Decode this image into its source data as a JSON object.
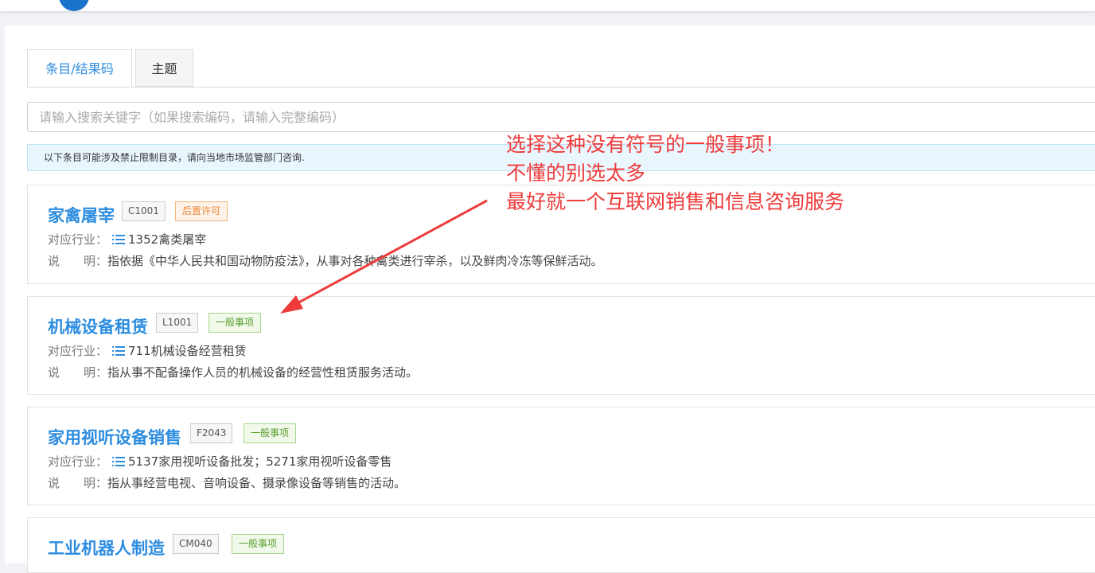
{
  "tabs": [
    {
      "label": "条目/结果码",
      "active": true
    },
    {
      "label": "主题",
      "active": false
    }
  ],
  "search": {
    "placeholder": "请输入搜索关键字（如果搜索编码，请输入完整编码）"
  },
  "notice": "以下条目可能涉及禁止限制目录，请向当地市场监管部门咨询.",
  "labels": {
    "industry": "对应行业：",
    "desc": "说　　明："
  },
  "items": [
    {
      "title": "家禽屠宰",
      "code": "C1001",
      "type": "后置许可",
      "industry": "1352禽类屠宰",
      "desc": "指依据《中华人民共和国动物防疫法》，从事对各种禽类进行宰杀，以及鲜肉冷冻等保鲜活动。"
    },
    {
      "title": "机械设备租赁",
      "code": "L1001",
      "type": "一般事项",
      "industry": "711机械设备经营租赁",
      "desc": "指从事不配备操作人员的机械设备的经营性租赁服务活动。"
    },
    {
      "title": "家用视听设备销售",
      "code": "F2043",
      "type": "一般事项",
      "industry": "5137家用视听设备批发；5271家用视听设备零售",
      "desc": "指从事经营电视、音响设备、摄录像设备等销售的活动。"
    },
    {
      "title": "工业机器人制造",
      "code": "CM040",
      "type": "一般事项"
    }
  ],
  "annotation": {
    "lines": [
      "选择这种没有符号的一般事项！",
      "不懂的别选太多",
      "最好就一个互联网销售和信息咨询服务"
    ],
    "color": "#ee3b3b"
  },
  "colors": {
    "accent": "#2e8de0",
    "tag_green": "#5a9e2f",
    "tag_orange": "#e8873a"
  }
}
